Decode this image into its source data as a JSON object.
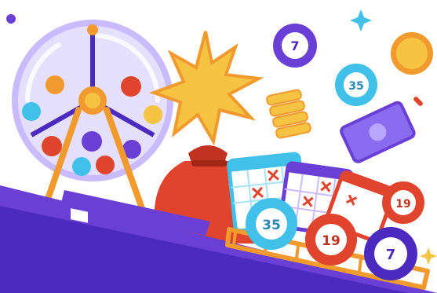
{
  "illustration": {
    "balls": {
      "ball_7_top": "7",
      "ball_35_top": "35",
      "ball_35_bottom": "35",
      "ball_19_right": "19",
      "ball_19_bottom": "19",
      "ball_7_bottom": "7"
    },
    "colors": {
      "purple": "#6a3fd6",
      "dark_purple": "#4b2bbf",
      "light_purple": "#b9a6ff",
      "orange": "#f29a2e",
      "red": "#e0442c",
      "teal": "#41c0ea",
      "gold": "#f6c343",
      "white": "#ffffff"
    }
  }
}
